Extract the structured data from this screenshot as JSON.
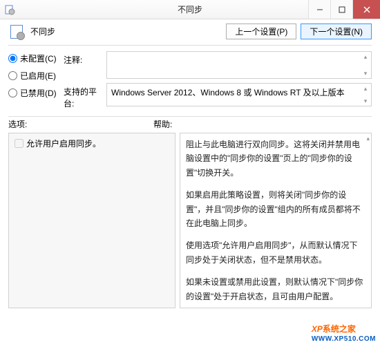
{
  "titlebar": {
    "title": "不同步"
  },
  "header": {
    "title": "不同步"
  },
  "nav": {
    "prev": "上一个设置(P)",
    "next": "下一个设置(N)"
  },
  "radios": {
    "unconfigured": "未配置(C)",
    "enabled": "已启用(E)",
    "disabled": "已禁用(D)"
  },
  "fields": {
    "comment_label": "注释:",
    "comment_value": "",
    "platform_label": "支持的平台:",
    "platform_value": "Windows Server 2012、Windows 8 或 Windows RT 及以上版本"
  },
  "section_labels": {
    "options": "选项:",
    "help": "帮助:"
  },
  "options": {
    "allow_user_sync": "允许用户启用同步。"
  },
  "help": {
    "p1": "阻止与此电脑进行双向同步。这将关闭并禁用电脑设置中的\"同步你的设置\"页上的\"同步你的设置\"切换开关。",
    "p2": "如果启用此策略设置，则将关闭\"同步你的设置\"，并且\"同步你的设置\"组内的所有成员都将不在此电脑上同步。",
    "p3": "使用选项\"允许用户启用同步\"，从而默认情况下同步处于关闭状态，但不是禁用状态。",
    "p4": "如果未设置或禁用此设置，则默认情况下\"同步你的设置\"处于开启状态，且可由用户配置。"
  },
  "watermark": {
    "brand": "系统之家",
    "url": "WWW.XP510.COM"
  }
}
